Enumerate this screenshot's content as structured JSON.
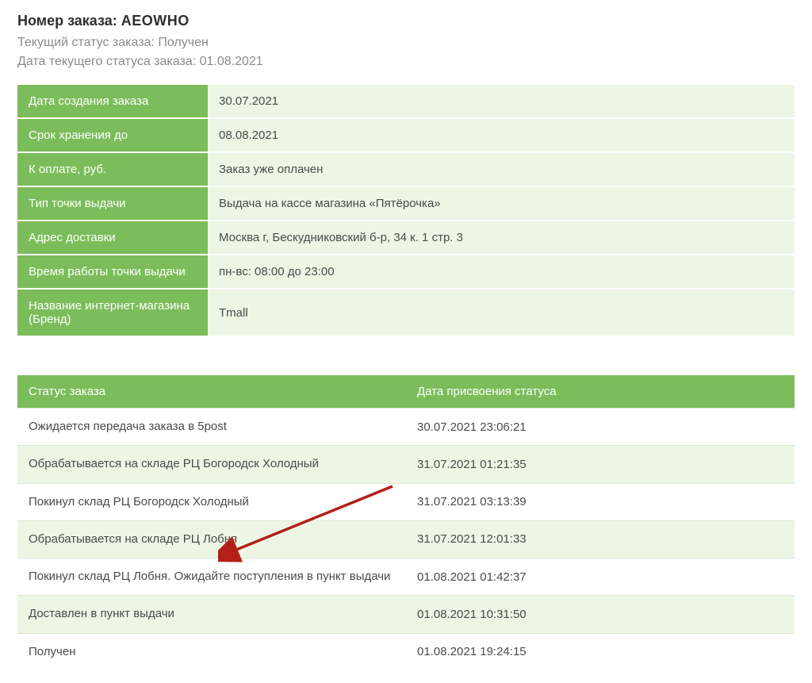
{
  "header": {
    "order_label": "Номер заказа:",
    "order_number": "AEOWHO",
    "status_label": "Текущий статус заказа:",
    "status_value": "Получен",
    "status_date_label": "Дата текущего статуса заказа:",
    "status_date_value": "01.08.2021"
  },
  "info_rows": [
    {
      "label": "Дата создания заказа",
      "value": "30.07.2021"
    },
    {
      "label": "Срок хранения до",
      "value": "08.08.2021"
    },
    {
      "label": "К оплате, руб.",
      "value": "Заказ уже оплачен"
    },
    {
      "label": "Тип точки выдачи",
      "value": "Выдача на кассе магазина «Пятёрочка»"
    },
    {
      "label": "Адрес доставки",
      "value": "Москва г, Бескудниковский б-р, 34 к. 1 стр. 3"
    },
    {
      "label": "Время работы точки выдачи",
      "value": "пн-вс: 08:00 до 23:00"
    },
    {
      "label": "Название интернет-магазина (Бренд)",
      "value": "Tmall"
    }
  ],
  "status_table": {
    "col1": "Статус заказа",
    "col2": "Дата присвоения статуса",
    "rows": [
      {
        "status": "Ожидается передача заказа в 5post",
        "date": "30.07.2021 23:06:21"
      },
      {
        "status": "Обрабатывается на складе РЦ Богородск Холодный",
        "date": "31.07.2021 01:21:35"
      },
      {
        "status": "Покинул склад РЦ Богородск Холодный",
        "date": "31.07.2021 03:13:39"
      },
      {
        "status": "Обрабатывается на складе РЦ Лобня",
        "date": "31.07.2021 12:01:33"
      },
      {
        "status": "Покинул склад РЦ Лобня. Ожидайте поступления в пункт выдачи",
        "date": "01.08.2021 01:42:37"
      },
      {
        "status": "Доставлен в пункт выдачи",
        "date": "01.08.2021 10:31:50"
      },
      {
        "status": "Получен",
        "date": "01.08.2021 19:24:15"
      }
    ]
  }
}
